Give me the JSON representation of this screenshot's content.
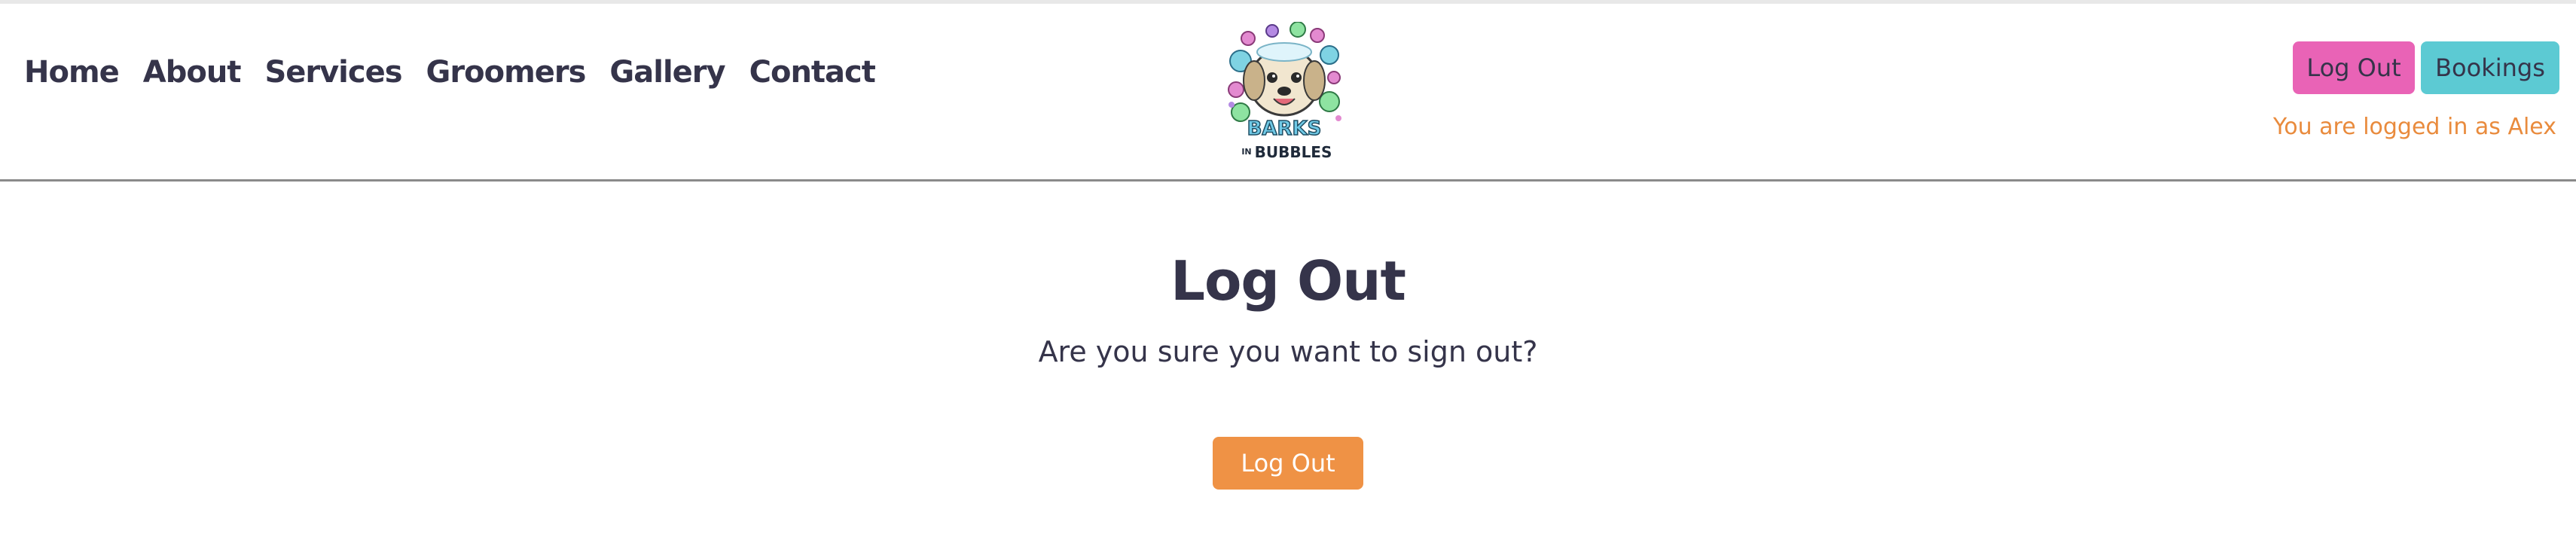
{
  "nav": {
    "items": [
      "Home",
      "About",
      "Services",
      "Groomers",
      "Gallery",
      "Contact"
    ]
  },
  "logo": {
    "text_top": "BARKS",
    "text_in": "IN",
    "text_bottom": "BUBBLES"
  },
  "auth": {
    "logout_label": "Log Out",
    "bookings_label": "Bookings",
    "status": "You are logged in as Alex"
  },
  "main": {
    "title": "Log Out",
    "confirm_text": "Are you sure you want to sign out?",
    "logout_button": "Log Out"
  },
  "colors": {
    "text": "#35344a",
    "pink": "#e963b6",
    "teal": "#5ccad3",
    "orange": "#ef9245",
    "status": "#e98b3d"
  }
}
